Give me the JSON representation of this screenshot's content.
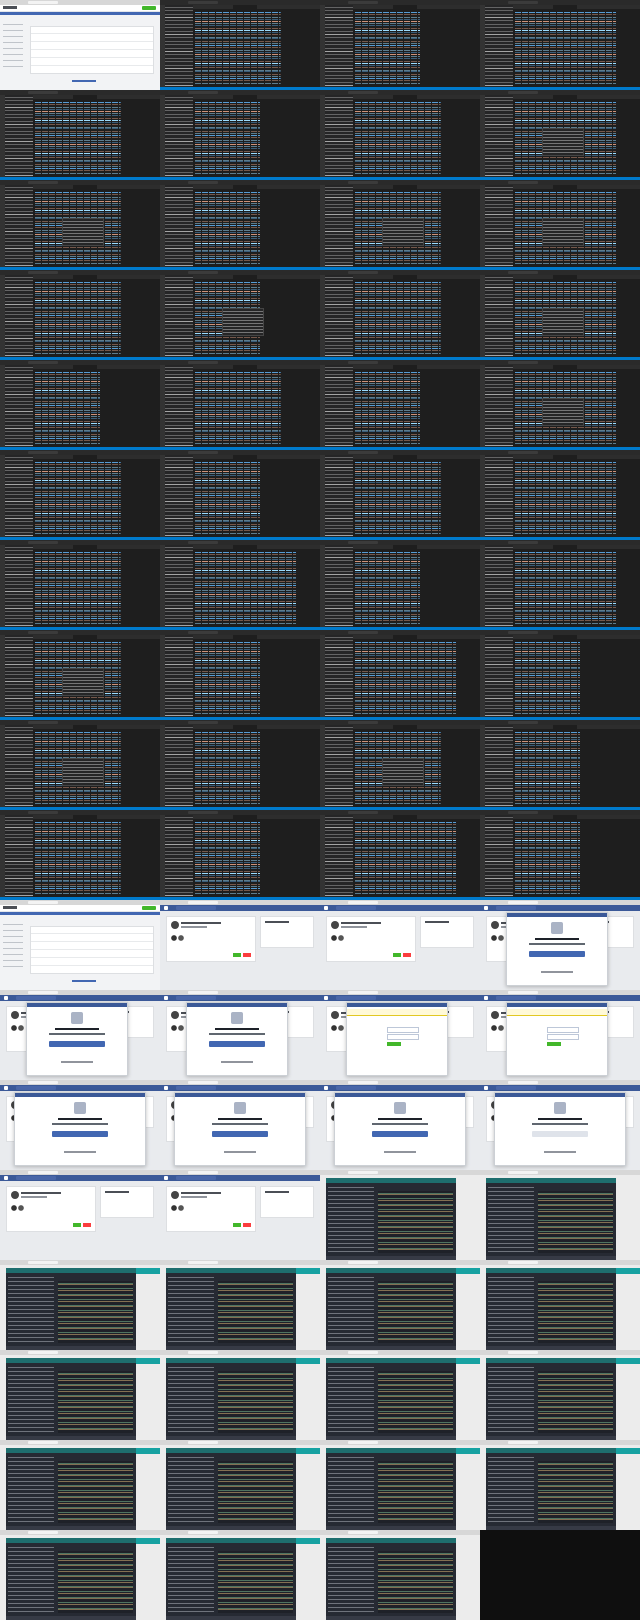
{
  "screenshot": {
    "description_kind": "contact-sheet",
    "grid": {
      "columns": 4,
      "rows": 18
    },
    "thumbnails": [
      {
        "kind": "admin"
      },
      {
        "kind": "vscode",
        "variant": "v1"
      },
      {
        "kind": "vscode",
        "variant": "v2"
      },
      {
        "kind": "vscode",
        "variant": "v3"
      },
      {
        "kind": "vscode",
        "variant": "v1"
      },
      {
        "kind": "vscode",
        "variant": "v2"
      },
      {
        "kind": "vscode",
        "variant": "v1"
      },
      {
        "kind": "vscode",
        "variant": "v3",
        "popup": true
      },
      {
        "kind": "vscode",
        "variant": "v1",
        "popup": true
      },
      {
        "kind": "vscode",
        "variant": "v2"
      },
      {
        "kind": "vscode",
        "variant": "v1",
        "popup": true
      },
      {
        "kind": "vscode",
        "variant": "v3",
        "popup": true
      },
      {
        "kind": "vscode",
        "variant": "v1"
      },
      {
        "kind": "vscode",
        "variant": "v2",
        "popup": true
      },
      {
        "kind": "vscode",
        "variant": "v1"
      },
      {
        "kind": "vscode",
        "variant": "v3",
        "popup": true
      },
      {
        "kind": "vscode",
        "variant": "v2"
      },
      {
        "kind": "vscode",
        "variant": "v1"
      },
      {
        "kind": "vscode",
        "variant": "v2"
      },
      {
        "kind": "vscode",
        "variant": "v3",
        "popup": true
      },
      {
        "kind": "vscode",
        "variant": "v1"
      },
      {
        "kind": "vscode",
        "variant": "v2"
      },
      {
        "kind": "vscode",
        "variant": "v1"
      },
      {
        "kind": "vscode",
        "variant": "v3"
      },
      {
        "kind": "vscode",
        "variant": "v1"
      },
      {
        "kind": "vscode",
        "variant": "v3"
      },
      {
        "kind": "vscode",
        "variant": "v2"
      },
      {
        "kind": "vscode",
        "variant": "v3"
      },
      {
        "kind": "vscode",
        "variant": "v1",
        "popup": true
      },
      {
        "kind": "vscode",
        "variant": "v2"
      },
      {
        "kind": "vscode",
        "variant": "v3"
      },
      {
        "kind": "vscode",
        "variant": "v2"
      },
      {
        "kind": "vscode",
        "variant": "v1",
        "popup": true
      },
      {
        "kind": "vscode",
        "variant": "v2"
      },
      {
        "kind": "vscode",
        "variant": "v1",
        "popup": true
      },
      {
        "kind": "vscode",
        "variant": "v2"
      },
      {
        "kind": "vscode",
        "variant": "v1"
      },
      {
        "kind": "vscode",
        "variant": "v2"
      },
      {
        "kind": "vscode",
        "variant": "v3"
      },
      {
        "kind": "vscode",
        "variant": "v2"
      },
      {
        "kind": "admin"
      },
      {
        "kind": "fb"
      },
      {
        "kind": "fb"
      },
      {
        "kind": "fb",
        "modal": "login"
      },
      {
        "kind": "fb",
        "modal": "login"
      },
      {
        "kind": "fb",
        "modal": "login"
      },
      {
        "kind": "fb",
        "modal": "form"
      },
      {
        "kind": "fb",
        "modal": "form"
      },
      {
        "kind": "fb",
        "modal": "wide"
      },
      {
        "kind": "fb",
        "modal": "wide"
      },
      {
        "kind": "fb",
        "modal": "wide"
      },
      {
        "kind": "fb",
        "modal": "wide-ghost"
      },
      {
        "kind": "fb"
      },
      {
        "kind": "fb"
      },
      {
        "kind": "dash",
        "teal": false
      },
      {
        "kind": "dash",
        "teal": false
      },
      {
        "kind": "dash",
        "teal": true
      },
      {
        "kind": "dash",
        "teal": true
      },
      {
        "kind": "dash",
        "teal": true
      },
      {
        "kind": "dash",
        "teal": true
      },
      {
        "kind": "dash",
        "teal": true
      },
      {
        "kind": "dash",
        "teal": true
      },
      {
        "kind": "dash",
        "teal": true
      },
      {
        "kind": "dash",
        "teal": true
      },
      {
        "kind": "dash",
        "teal": true
      },
      {
        "kind": "dash",
        "teal": true
      },
      {
        "kind": "dash",
        "teal": true
      },
      {
        "kind": "dash",
        "teal": true
      },
      {
        "kind": "dash",
        "teal": true
      },
      {
        "kind": "dash",
        "teal": true
      },
      {
        "kind": "dash",
        "teal": false
      },
      {
        "kind": "blank"
      }
    ]
  },
  "colors": {
    "vscode_bg": "#1e1e1e",
    "vscode_status": "#007acc",
    "facebook_blue": "#3b5998",
    "accent_green": "#42b72a",
    "dashboard_teal": "#17a2a2",
    "sheet_bg": "#0f0f0f"
  }
}
